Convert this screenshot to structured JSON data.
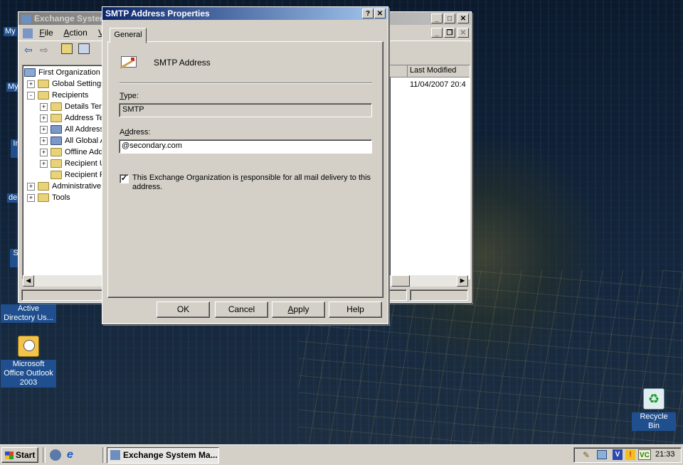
{
  "desktop": {
    "icons": [
      {
        "label": "My"
      },
      {
        "label": "My"
      },
      {
        "label": "In"
      },
      {
        "label": "de"
      },
      {
        "label": "S"
      },
      {
        "label": "Active Directory Us..."
      },
      {
        "label": "Microsoft Office Outlook 2003"
      },
      {
        "label": "Recycle Bin"
      }
    ]
  },
  "esm_window": {
    "title": "Exchange System Manager",
    "title_visible": "Exchange Syster",
    "menu": [
      {
        "pre": "",
        "u": "F",
        "post": "ile"
      },
      {
        "pre": "",
        "u": "A",
        "post": "ction"
      },
      {
        "pre": "",
        "u": "V",
        "post": "ie"
      }
    ],
    "tree": [
      {
        "label": "First Organization",
        "level": 0,
        "expander": ""
      },
      {
        "label": "Global Settings",
        "level": 1,
        "expander": "+"
      },
      {
        "label": "Recipients",
        "level": 1,
        "expander": "-"
      },
      {
        "label": "Details Ter",
        "level": 2,
        "expander": "+"
      },
      {
        "label": "Address Te",
        "level": 2,
        "expander": "+"
      },
      {
        "label": "All Address",
        "level": 2,
        "expander": "+"
      },
      {
        "label": "All Global A",
        "level": 2,
        "expander": "+"
      },
      {
        "label": "Offline Add",
        "level": 2,
        "expander": "+"
      },
      {
        "label": "Recipient U",
        "level": 2,
        "expander": "+"
      },
      {
        "label": "Recipient P",
        "level": 2,
        "expander": ""
      },
      {
        "label": "Administrative",
        "level": 1,
        "expander": "+"
      },
      {
        "label": "Tools",
        "level": 1,
        "expander": "+"
      }
    ],
    "list_header": "Last Modified",
    "list_value": "11/04/2007 20:4"
  },
  "dialog": {
    "title": "SMTP Address Properties",
    "help_btn": "?",
    "close_btn": "✕",
    "tab": "General",
    "heading": "SMTP Address",
    "type_label_u": "T",
    "type_label_rest": "ype:",
    "type_value": "SMTP",
    "address_label_pre": "A",
    "address_label_u": "d",
    "address_label_rest": "dress:",
    "address_value": "@secondary.com",
    "checkbox_text_pre": "This Exchange Organization is ",
    "checkbox_text_u": "r",
    "checkbox_text_post": "esponsible for all mail delivery to this address.",
    "checkbox_checked": true,
    "ok": "OK",
    "cancel": "Cancel",
    "apply_u": "A",
    "apply_rest": "pply",
    "help": "Help"
  },
  "taskbar": {
    "start": "Start",
    "task": "Exchange System Ma...",
    "clock": "21:33"
  }
}
